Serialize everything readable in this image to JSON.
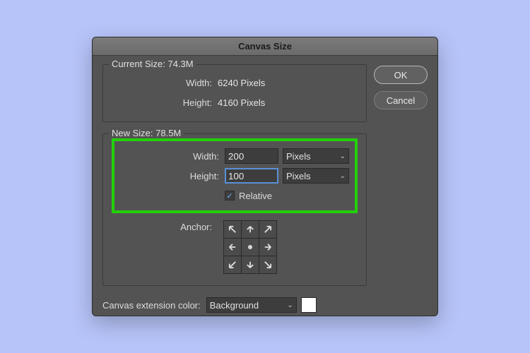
{
  "title": "Canvas Size",
  "buttons": {
    "ok": "OK",
    "cancel": "Cancel"
  },
  "current": {
    "title": "Current Size: 74.3M",
    "width_label": "Width:",
    "width_value": "6240 Pixels",
    "height_label": "Height:",
    "height_value": "4160 Pixels"
  },
  "newsize": {
    "title": "New Size: 78.5M",
    "width_label": "Width:",
    "width_value": "200",
    "width_unit": "Pixels",
    "height_label": "Height:",
    "height_value": "100",
    "height_unit": "Pixels",
    "relative_label": "Relative",
    "relative_checked": true,
    "anchor_label": "Anchor:"
  },
  "extension": {
    "label": "Canvas extension color:",
    "value": "Background",
    "swatch": "#ffffff"
  }
}
